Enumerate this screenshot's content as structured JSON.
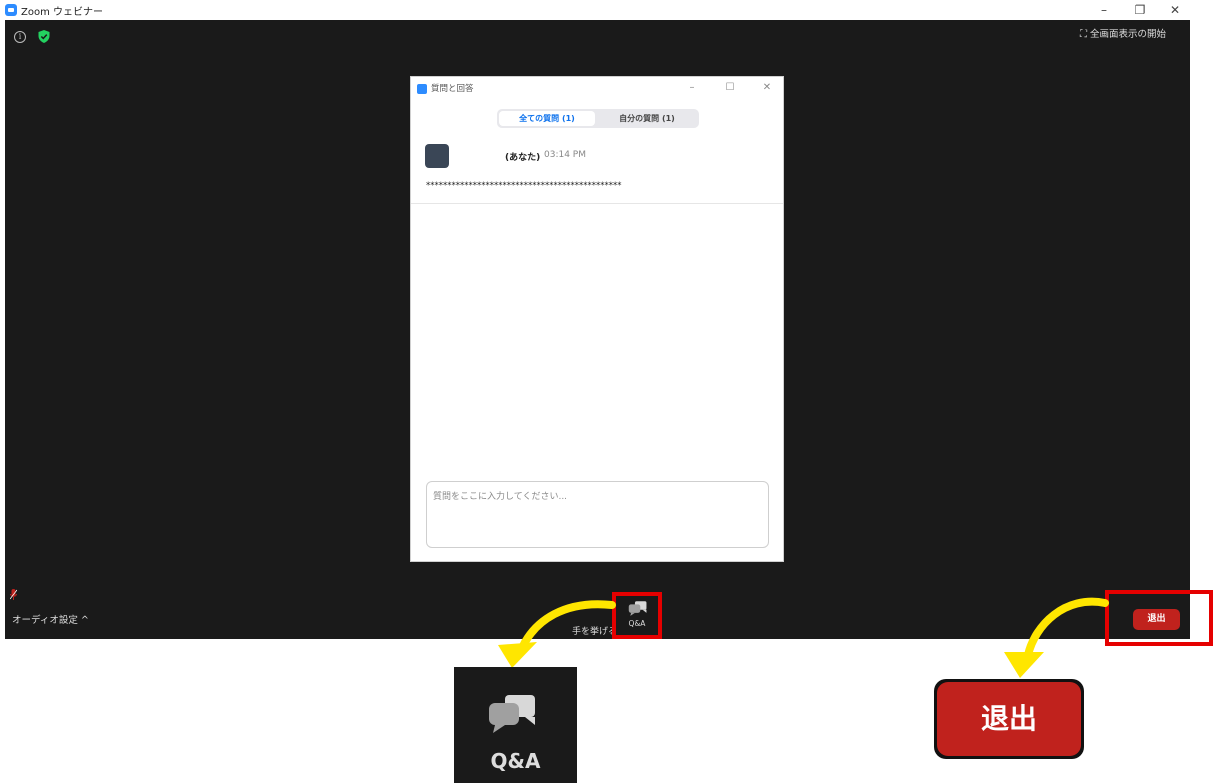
{
  "window": {
    "title": "Zoom ウェビナー",
    "minimize": "–",
    "restore": "❐",
    "close": "✕"
  },
  "toolbar_top": {
    "fullscreen_label": "全画面表示の開始",
    "info_icon": "info-icon",
    "security_icon": "shield-check-icon"
  },
  "qa_dialog": {
    "title": "質問と回答",
    "minimize": "–",
    "maximize": "☐",
    "close": "✕",
    "tabs": [
      {
        "label": "全ての質問 (1)",
        "selected": true
      },
      {
        "label": "自分の質問 (1)",
        "selected": false
      }
    ],
    "question": {
      "author": "(あなた)",
      "time": "03:14 PM",
      "text": "**********************************************"
    },
    "input_placeholder": "質問をここに入力してください..."
  },
  "bottom_toolbar": {
    "audio_settings": "オーディオ設定 ^",
    "raise_hand": "手を挙げる",
    "qa_label": "Q&A",
    "exit_label": "退出"
  },
  "callouts": {
    "qa_label": "Q&A",
    "exit_label": "退出"
  },
  "colors": {
    "video_bg": "#1a1a1a",
    "accent_blue": "#2d8cff",
    "exit_red": "#c0221d",
    "highlight_red": "#e50000",
    "arrow_yellow": "#ffe600"
  }
}
